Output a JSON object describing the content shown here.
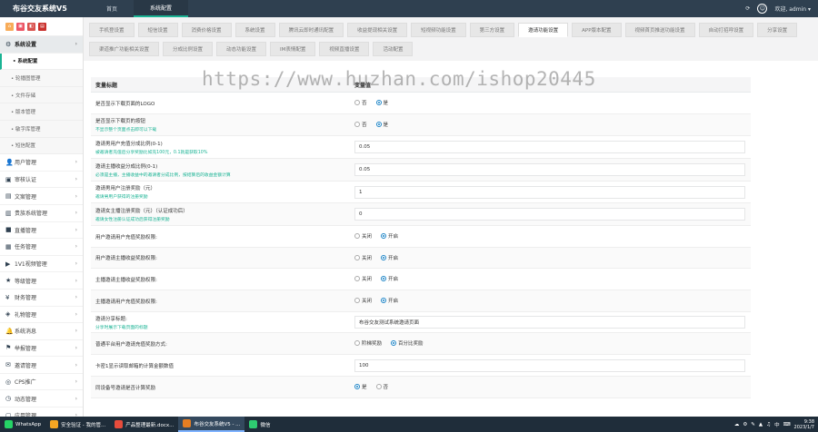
{
  "app": {
    "title": "布谷交友系统V5",
    "top_tabs": [
      {
        "label": "首页",
        "active": false
      },
      {
        "label": "系统配置",
        "active": true
      }
    ],
    "user_label": "欢迎, admin",
    "user_caret": "▾",
    "refresh_glyph": "⟳",
    "avatar_glyph": "☺"
  },
  "sidebar": {
    "tool_glyphs": [
      "⌂",
      "▣",
      "◧",
      "▤"
    ],
    "groups_before": [
      {
        "icon": "gear-icon",
        "glyph": "⚙",
        "label": "系统设置",
        "open": true
      }
    ],
    "submenu": [
      {
        "label": "• 系统配置",
        "active": true
      },
      {
        "label": "• 轮播图管理",
        "active": false
      },
      {
        "label": "• 文件存储",
        "active": false
      },
      {
        "label": "• 版本管理",
        "active": false
      },
      {
        "label": "• 敏字库管理",
        "active": false
      },
      {
        "label": "• 短信配置",
        "active": false
      }
    ],
    "groups": [
      {
        "icon": "user-icon",
        "glyph": "👤",
        "label": "用户管理"
      },
      {
        "icon": "certificate-icon",
        "glyph": "▣",
        "label": "审核认证"
      },
      {
        "icon": "document-icon",
        "glyph": "▤",
        "label": "文案管理"
      },
      {
        "icon": "vip-icon",
        "glyph": "▥",
        "label": "贵族系统管理"
      },
      {
        "icon": "live-icon",
        "glyph": "■",
        "label": "直播管理"
      },
      {
        "icon": "task-icon",
        "glyph": "▦",
        "label": "任务管理"
      },
      {
        "icon": "video-icon",
        "glyph": "▶",
        "label": "1V1视频管理"
      },
      {
        "icon": "grade-icon",
        "glyph": "★",
        "label": "等级管理"
      },
      {
        "icon": "finance-icon",
        "glyph": "¥",
        "label": "财务管理"
      },
      {
        "icon": "gift-icon",
        "glyph": "◈",
        "label": "礼物管理"
      },
      {
        "icon": "message-icon",
        "glyph": "🔔",
        "label": "系统消息"
      },
      {
        "icon": "report-icon",
        "glyph": "⚑",
        "label": "举报管理"
      },
      {
        "icon": "invite-icon",
        "glyph": "✉",
        "label": "邀请管理"
      },
      {
        "icon": "cps-icon",
        "glyph": "◎",
        "label": "CPS推广"
      },
      {
        "icon": "dynamic-icon",
        "glyph": "◷",
        "label": "动态管理"
      },
      {
        "icon": "app-icon",
        "glyph": "▢",
        "label": "应用管理"
      }
    ],
    "chevron_glyph": "›"
  },
  "settings_tabs": {
    "row1": [
      {
        "label": "手机登设置",
        "active": false
      },
      {
        "label": "短信设置",
        "active": false
      },
      {
        "label": "消费价格设置",
        "active": false
      },
      {
        "label": "系统设置",
        "active": false
      },
      {
        "label": "腾讯云即时通讯配置",
        "active": false
      },
      {
        "label": "收益提现相关设置",
        "active": false
      },
      {
        "label": "短视频功能设置",
        "active": false
      },
      {
        "label": "第三方设置",
        "active": false
      },
      {
        "label": "邀请功能设置",
        "active": true
      },
      {
        "label": "APP版本配置",
        "active": false
      },
      {
        "label": "视频首页推送功能设置",
        "active": false
      },
      {
        "label": "自动打招呼设置",
        "active": false
      },
      {
        "label": "分享设置",
        "active": false
      }
    ],
    "row2": [
      {
        "label": "渠道推广功能相关设置",
        "active": false
      },
      {
        "label": "分成比例设置",
        "active": false
      },
      {
        "label": "动态功能设置",
        "active": false
      },
      {
        "label": "IM表情配置",
        "active": false
      },
      {
        "label": "视频直播设置",
        "active": false
      },
      {
        "label": "活动配置",
        "active": false
      }
    ]
  },
  "watermark": "https://www.huzhan.com/ishop20445",
  "table": {
    "col_name": "变量标题",
    "col_value": "变量值",
    "rows": [
      {
        "label": "是否显示下载页面的LOGO",
        "hint": "",
        "type": "radio",
        "options": [
          {
            "label": "否",
            "on": false
          },
          {
            "label": "是",
            "on": true
          }
        ]
      },
      {
        "label": "是否显示下载页的按钮",
        "hint": "不显示整个页面点击即可以下载",
        "type": "radio",
        "options": [
          {
            "label": "否",
            "on": false
          },
          {
            "label": "是",
            "on": true
          }
        ]
      },
      {
        "label": "邀请男用户充值分成比例(0-1)",
        "hint": "被邀请者充值后分享奖励比如充100元，0.1就是获取10%",
        "type": "input",
        "value": "0.05"
      },
      {
        "label": "邀请主播收益分成比例(0-1)",
        "hint": "必须是主播，主播收益中的邀请者分成比例，按结算后的收益金额计算",
        "type": "input",
        "value": "0.05"
      },
      {
        "label": "邀请男用户注册奖励（元）",
        "hint": "邀请男用户获得的注册奖励",
        "type": "input",
        "value": "1"
      },
      {
        "label": "邀请女主播注册奖励（元）（认证成功后）",
        "hint": "邀请女性注册认证成功后获得注册奖励",
        "type": "input",
        "value": "0"
      },
      {
        "label": "用户邀请用户充值奖励权限:",
        "hint": "",
        "type": "radio",
        "options": [
          {
            "label": "关闭",
            "on": false
          },
          {
            "label": "开启",
            "on": true
          }
        ]
      },
      {
        "label": "用户邀请主播收益奖励权限:",
        "hint": "",
        "type": "radio",
        "options": [
          {
            "label": "关闭",
            "on": false
          },
          {
            "label": "开启",
            "on": true
          }
        ]
      },
      {
        "label": "主播邀请主播收益奖励权限:",
        "hint": "",
        "type": "radio",
        "options": [
          {
            "label": "关闭",
            "on": false
          },
          {
            "label": "开启",
            "on": true
          }
        ]
      },
      {
        "label": "主播邀请用户充值奖励权限:",
        "hint": "",
        "type": "radio",
        "options": [
          {
            "label": "关闭",
            "on": false
          },
          {
            "label": "开启",
            "on": true
          }
        ]
      },
      {
        "label": "邀请分享标题:",
        "hint": "分享时展示下载页面的标题",
        "type": "input",
        "value": "布谷交友测试系统邀请页面"
      },
      {
        "label": "普通平台用户邀请充值奖励方式:",
        "hint": "",
        "type": "radio",
        "options": [
          {
            "label": "阶梯奖励",
            "on": false
          },
          {
            "label": "百分比奖励",
            "on": true
          }
        ]
      },
      {
        "label": "卡密1显示读取邮箱的计算金额数值",
        "hint": "",
        "type": "input",
        "value": "100"
      },
      {
        "label": "同设备号邀请是否计算奖励",
        "hint": "",
        "type": "radio",
        "options": [
          {
            "label": "是",
            "on": true
          },
          {
            "label": "否",
            "on": false
          }
        ]
      }
    ]
  },
  "taskbar": {
    "items": [
      {
        "label": "WhatsApp",
        "color": "#25d366",
        "active": false
      },
      {
        "label": "安全验证 - 我的管...",
        "color": "#f5a623",
        "active": false
      },
      {
        "label": "产品整理最新.docx...",
        "color": "#e74c3c",
        "active": false
      },
      {
        "label": "布谷交友系统V5 - ...",
        "color": "#e67e22",
        "active": true
      },
      {
        "label": "微信",
        "color": "#2ecc71",
        "active": false
      }
    ],
    "tray_glyphs": [
      "☁",
      "⚙",
      "✎",
      "▲",
      "♫",
      "中",
      "⌨"
    ],
    "time": "9:38",
    "date": "2023/1/7"
  }
}
